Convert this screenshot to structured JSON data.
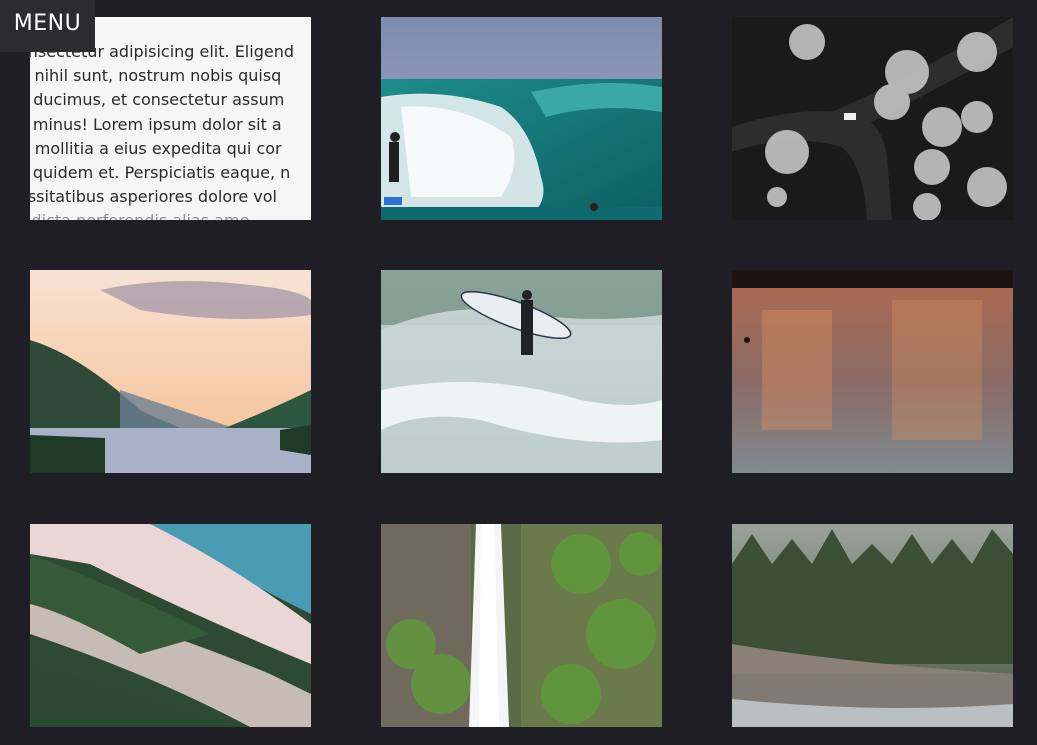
{
  "menu": {
    "label": "MENU"
  },
  "text_tile": {
    "lines": [
      "onsectetur adipisicing elit. Eligend",
      "t, nihil sunt, nostrum nobis quisq",
      "n ducimus, et consectetur assum",
      "o minus! Lorem ipsum dolor sit a",
      "r, mollitia a eius expedita qui cor",
      "o quidem et. Perspiciatis eaque, n",
      "essitatibus asperiores dolore vol",
      "s dicta perferendis alias ame"
    ]
  },
  "gallery": {
    "tiles": [
      {
        "name": "text-card",
        "kind": "text"
      },
      {
        "name": "surfer-wave-photo",
        "kind": "photo"
      },
      {
        "name": "forest-road-aerial-photo",
        "kind": "photo"
      },
      {
        "name": "mountain-lake-sunset-photo",
        "kind": "photo"
      },
      {
        "name": "surfer-carrying-board-photo",
        "kind": "photo"
      },
      {
        "name": "lake-reflection-photo",
        "kind": "photo"
      },
      {
        "name": "snowy-mountain-slope-photo",
        "kind": "photo"
      },
      {
        "name": "waterfall-photo",
        "kind": "photo"
      },
      {
        "name": "forest-river-photo",
        "kind": "photo"
      }
    ]
  }
}
